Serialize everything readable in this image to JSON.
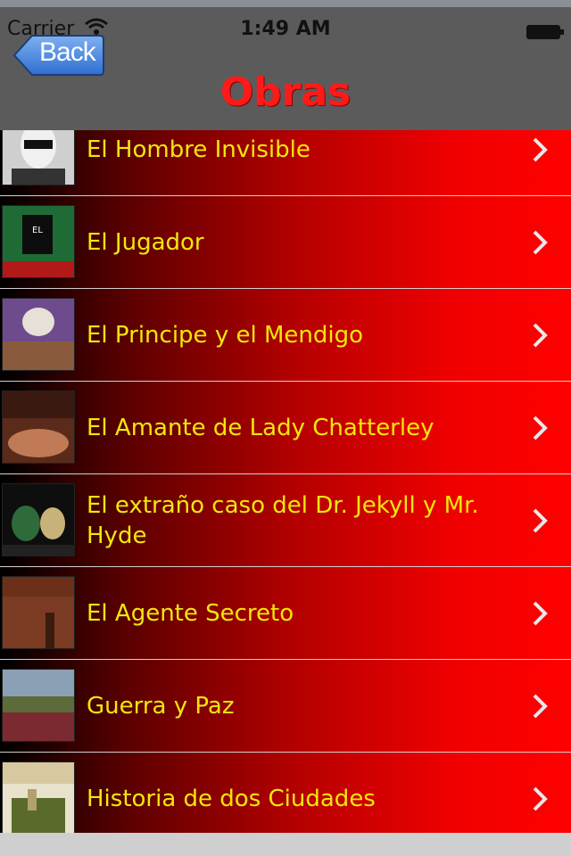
{
  "status_bar": {
    "carrier": "Carrier",
    "time": "1:49 AM"
  },
  "navbar": {
    "back_label": "Back",
    "title": "Obras"
  },
  "books": [
    {
      "title": "El Hombre Invisible",
      "icon": "invisible-man-cover"
    },
    {
      "title": "El Jugador",
      "icon": "el-jugador-cover"
    },
    {
      "title": "El Principe y el Mendigo",
      "icon": "principe-mendigo-cover"
    },
    {
      "title": "El Amante de Lady Chatterley",
      "icon": "lady-chatterley-cover"
    },
    {
      "title": "El extraño caso del Dr. Jekyll y Mr. Hyde",
      "icon": "jekyll-hyde-cover"
    },
    {
      "title": "El Agente Secreto",
      "icon": "agente-secreto-cover"
    },
    {
      "title": "Guerra y Paz",
      "icon": "guerra-paz-cover"
    },
    {
      "title": "Historia de dos Ciudades",
      "icon": "dos-ciudades-cover"
    }
  ],
  "colors": {
    "title_red": "#ff1a1a",
    "label_yellow": "#f2e70c",
    "bar_gray": "#5b5b5b"
  }
}
